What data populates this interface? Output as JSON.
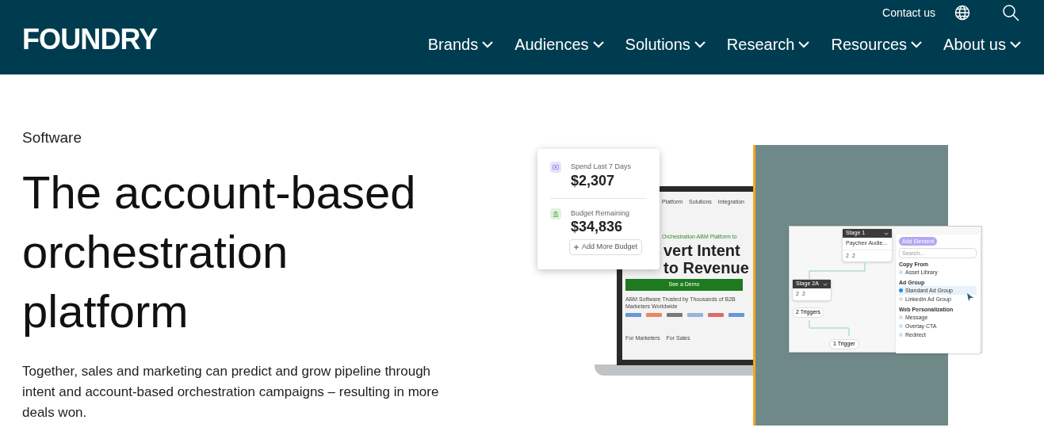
{
  "header": {
    "logo": "FOUNDRY",
    "contact": "Contact us",
    "nav": [
      {
        "label": "Brands"
      },
      {
        "label": "Audiences"
      },
      {
        "label": "Solutions"
      },
      {
        "label": "Research"
      },
      {
        "label": "Resources"
      },
      {
        "label": "About us"
      }
    ]
  },
  "hero": {
    "eyebrow": "Software",
    "title_lines": [
      "The account-based",
      "orchestration",
      "platform"
    ],
    "body": "Together, sales and marketing can predict and grow pipeline through intent and account-based orchestration campaigns – resulting in more deals won."
  },
  "stats_card": {
    "stats": [
      {
        "label": "Spend Last 7 Days",
        "value": "$2,307",
        "kind": "spend"
      },
      {
        "label": "Budget Remaining",
        "value": "$34,836",
        "kind": "budget"
      }
    ],
    "button": "Add More Budget"
  },
  "laptop_site": {
    "nav": [
      "Platform",
      "Solutions",
      "Integration"
    ],
    "kicker": "Orchestration ABM Platform to",
    "headline_lines": [
      "vert Intent",
      "to Revenue"
    ],
    "cta": "See a Demo",
    "trust": "ABM Software Trusted by Thousands of B2B Marketers Worldwide",
    "tabs": [
      "For Marketers",
      "For Sales"
    ]
  },
  "workflow": {
    "nodes": [
      {
        "title": "Stage 1",
        "subtitle": "Paychex Audie...",
        "count_a": "2",
        "count_b": "2"
      },
      {
        "title": "Stage 2A",
        "count_a": "2",
        "count_b": "2",
        "trigger": "2 Triggers"
      }
    ],
    "trigger_bottom": "1 Trigger",
    "panel": {
      "title": "Add Element",
      "search_placeholder": "Search...",
      "groups": [
        {
          "heading": "Copy From",
          "items": [
            {
              "label": "Asset Library",
              "selected": false
            }
          ]
        },
        {
          "heading": "Ad Group",
          "items": [
            {
              "label": "Standard Ad Group",
              "selected": true
            },
            {
              "label": "LinkedIn Ad Group",
              "selected": false
            }
          ]
        },
        {
          "heading": "Web Personalization",
          "items": [
            {
              "label": "Message",
              "selected": false
            },
            {
              "label": "Overlay CTA",
              "selected": false
            },
            {
              "label": "Redirect",
              "selected": false
            }
          ]
        }
      ]
    }
  }
}
